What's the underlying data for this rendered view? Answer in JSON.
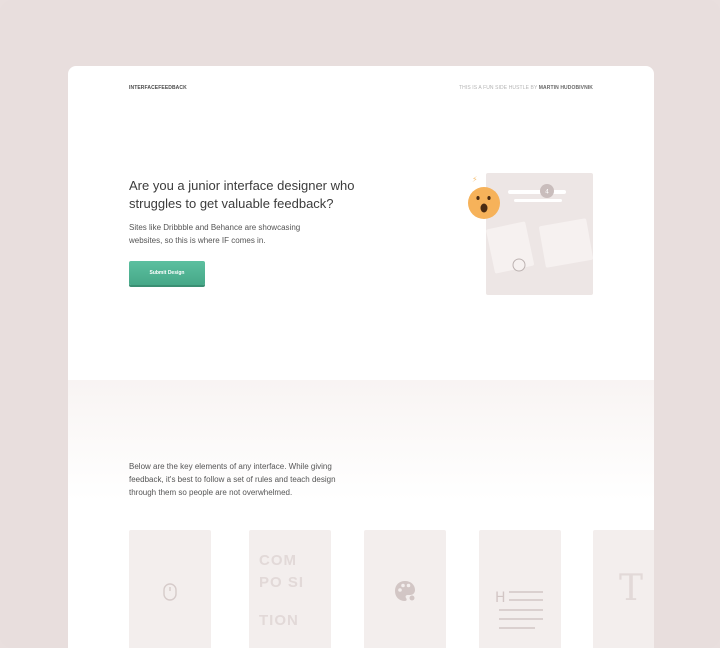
{
  "header": {
    "brand": "INTERFACEFEEDBACK",
    "credit_prefix": "THIS IS A FUN SIDE HUSTLE BY",
    "credit_name": "MARTIN HUDOBIVNIK"
  },
  "hero": {
    "headline": "Are you a junior interface designer who struggles to get valuable feedback?",
    "subtext": "Sites like Dribbble and Behance are showcasing websites, so this is where IF comes in.",
    "cta_label": "Submit Design"
  },
  "section": {
    "intro": "Below are the key elements of any interface. While giving feedback, it's best to follow a set of rules and teach design through them so people are not overwhelmed."
  },
  "cards": [
    {
      "name": "mouse-icon"
    },
    {
      "name": "composition",
      "lines": [
        "COM",
        "PO SI",
        "TION"
      ]
    },
    {
      "name": "palette-icon"
    },
    {
      "name": "typography-heading-icon",
      "glyph": "H"
    },
    {
      "name": "typography-serif-icon",
      "glyph": "T"
    }
  ],
  "colors": {
    "background": "#e8dedd",
    "accent": "#55b898",
    "card": "#f3eeed",
    "emoji": "#f6b25a"
  }
}
